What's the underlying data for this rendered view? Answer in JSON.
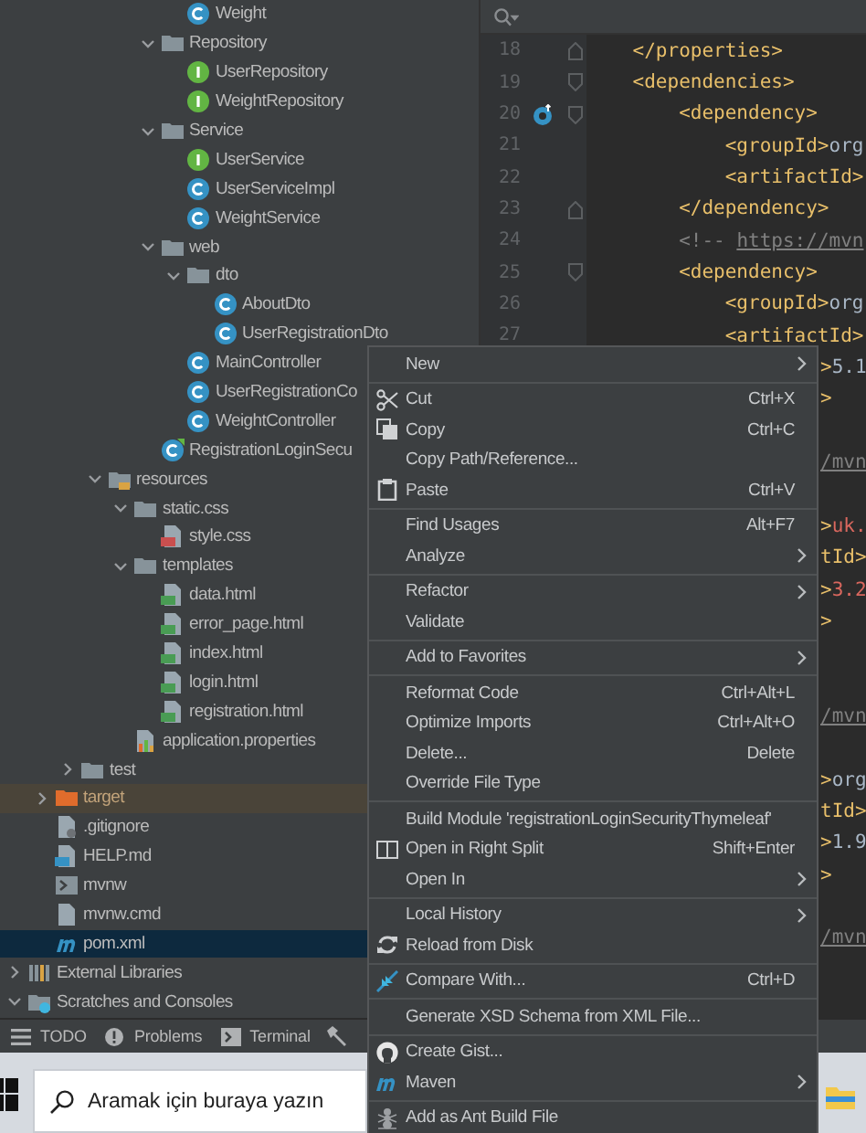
{
  "tree": [
    {
      "children": [
        {
          "children": [
            {
              "children": [
                {
                  "children": [
                    {
                      "children": [
                        {
                          "children": [
                            {
                              "label": "Weight",
                              "kind": "class",
                              "selected": false
                            }
                          ]
                        },
                        {
                          "label": "Repository",
                          "kind": "folder",
                          "expanded": true,
                          "selected": false,
                          "children": [
                            {
                              "label": "UserRepository",
                              "kind": "interface",
                              "selected": false
                            },
                            {
                              "label": "WeightRepository",
                              "kind": "interface",
                              "selected": false
                            }
                          ]
                        },
                        {
                          "label": "Service",
                          "kind": "folder",
                          "expanded": true,
                          "selected": false,
                          "children": [
                            {
                              "label": "UserService",
                              "kind": "interface",
                              "selected": false
                            },
                            {
                              "label": "UserServiceImpl",
                              "kind": "class",
                              "selected": false
                            },
                            {
                              "label": "WeightService",
                              "kind": "class",
                              "selected": false
                            }
                          ]
                        },
                        {
                          "label": "web",
                          "kind": "folder",
                          "expanded": true,
                          "selected": false,
                          "children": [
                            {
                              "label": "dto",
                              "kind": "folder",
                              "expanded": true,
                              "selected": false,
                              "children": [
                                {
                                  "label": "AboutDto",
                                  "kind": "class",
                                  "selected": false
                                },
                                {
                                  "label": "UserRegistrationDto",
                                  "kind": "class",
                                  "selected": false
                                }
                              ]
                            },
                            {
                              "label": "MainController",
                              "kind": "class",
                              "selected": false
                            },
                            {
                              "label": "UserRegistrationCo",
                              "kind": "class",
                              "selected": false
                            },
                            {
                              "label": "WeightController",
                              "kind": "class",
                              "selected": false
                            }
                          ]
                        },
                        {
                          "label": "RegistrationLoginSecu",
                          "kind": "app",
                          "selected": false
                        }
                      ]
                    }
                  ]
                },
                {
                  "label": "resources",
                  "kind": "resources",
                  "expanded": true,
                  "selected": false,
                  "children": [
                    {
                      "label": "static.css",
                      "kind": "folder",
                      "expanded": true,
                      "selected": false,
                      "children": [
                        {
                          "label": "style.css",
                          "kind": "css",
                          "selected": false
                        }
                      ]
                    },
                    {
                      "label": "templates",
                      "kind": "folder",
                      "expanded": true,
                      "selected": false,
                      "children": [
                        {
                          "label": "data.html",
                          "kind": "html",
                          "selected": false
                        },
                        {
                          "label": "error_page.html",
                          "kind": "html",
                          "selected": false
                        },
                        {
                          "label": "index.html",
                          "kind": "html",
                          "selected": false
                        },
                        {
                          "label": "login.html",
                          "kind": "html",
                          "selected": false
                        },
                        {
                          "label": "registration.html",
                          "kind": "html",
                          "selected": false
                        }
                      ]
                    },
                    {
                      "label": "application.properties",
                      "kind": "properties",
                      "selected": false
                    }
                  ]
                }
              ]
            },
            {
              "label": "test",
              "kind": "folder",
              "expanded": false,
              "selected": false
            }
          ]
        },
        {
          "label": "target",
          "kind": "excluded",
          "expanded": false,
          "selected": false
        },
        {
          "label": ".gitignore",
          "kind": "git",
          "selected": false
        },
        {
          "label": "HELP.md",
          "kind": "md",
          "selected": false
        },
        {
          "label": "mvnw",
          "kind": "terminal",
          "selected": false
        },
        {
          "label": "mvnw.cmd",
          "kind": "file",
          "selected": false
        },
        {
          "label": "pom.xml",
          "kind": "maven",
          "selected": true
        }
      ]
    },
    {
      "label": "External Libraries",
      "kind": "libraries",
      "expanded": false,
      "selected": false
    },
    {
      "label": "Scratches and Consoles",
      "kind": "scratches",
      "expanded": true,
      "selected": false
    }
  ],
  "editor": {
    "lines": [
      {
        "number": "18",
        "kind": "fold-close",
        "parts": [
          {
            "text": "    </properties>",
            "kind": "tag"
          }
        ]
      },
      {
        "number": "19",
        "kind": "fold-open",
        "parts": [
          {
            "text": "    <dependencies>",
            "kind": "tag"
          }
        ]
      },
      {
        "number": "20",
        "kind": "fold-open",
        "marker": true,
        "parts": [
          {
            "text": "        <dependency>",
            "kind": "tag"
          }
        ]
      },
      {
        "number": "21",
        "kind": "plain",
        "parts": [
          {
            "text": "            <groupId>",
            "kind": "tag"
          },
          {
            "text": "org",
            "kind": "text"
          }
        ]
      },
      {
        "number": "22",
        "kind": "plain",
        "parts": [
          {
            "text": "            <artifactId>",
            "kind": "tag"
          }
        ]
      },
      {
        "number": "23",
        "kind": "fold-close",
        "parts": [
          {
            "text": "        </dependency>",
            "kind": "tag"
          }
        ]
      },
      {
        "number": "24",
        "kind": "plain",
        "parts": [
          {
            "text": "        <!-- ",
            "kind": "comment"
          },
          {
            "text": "https://mvn",
            "kind": "link"
          }
        ]
      },
      {
        "number": "25",
        "kind": "fold-open",
        "parts": [
          {
            "text": "        <dependency>",
            "kind": "tag"
          }
        ]
      },
      {
        "number": "26",
        "kind": "plain",
        "parts": [
          {
            "text": "            <groupId>",
            "kind": "tag"
          },
          {
            "text": "org",
            "kind": "text"
          }
        ]
      },
      {
        "number": "27",
        "kind": "plain",
        "parts": [
          {
            "text": "            <artifactId>",
            "kind": "tag"
          }
        ]
      },
      {
        "kind": "tail",
        "parts": [
          {
            "text": ">",
            "kind": "tag"
          },
          {
            "text": "5.1",
            "kind": "text"
          }
        ]
      },
      {
        "kind": "tail",
        "parts": [
          {
            "text": ">",
            "kind": "tag"
          }
        ]
      },
      {
        "kind": "blank"
      },
      {
        "kind": "tail",
        "parts": [
          {
            "text": "/mvn",
            "kind": "link"
          }
        ]
      },
      {
        "kind": "blank"
      },
      {
        "kind": "tail",
        "parts": [
          {
            "text": ">",
            "kind": "tag"
          },
          {
            "text": "uk.",
            "kind": "red"
          }
        ]
      },
      {
        "kind": "tail",
        "parts": [
          {
            "text": "tId>",
            "kind": "tag"
          }
        ]
      },
      {
        "kind": "tail",
        "parts": [
          {
            "text": ">",
            "kind": "tag"
          },
          {
            "text": "3.2",
            "kind": "red"
          }
        ]
      },
      {
        "kind": "tail",
        "parts": [
          {
            "text": ">",
            "kind": "tag"
          }
        ]
      },
      {
        "kind": "blank"
      },
      {
        "kind": "blank"
      },
      {
        "kind": "tail",
        "parts": [
          {
            "text": "/mvn",
            "kind": "link"
          }
        ]
      },
      {
        "kind": "blank"
      },
      {
        "kind": "tail",
        "parts": [
          {
            "text": ">",
            "kind": "tag"
          },
          {
            "text": "org",
            "kind": "text"
          }
        ]
      },
      {
        "kind": "tail",
        "parts": [
          {
            "text": "tId>",
            "kind": "tag"
          }
        ]
      },
      {
        "kind": "tail",
        "parts": [
          {
            "text": ">",
            "kind": "tag"
          },
          {
            "text": "1.9",
            "kind": "text"
          }
        ]
      },
      {
        "kind": "tail",
        "parts": [
          {
            "text": ">",
            "kind": "tag"
          }
        ]
      },
      {
        "kind": "blank"
      },
      {
        "kind": "tail",
        "parts": [
          {
            "text": "/mvn",
            "kind": "link"
          }
        ]
      }
    ]
  },
  "context_menu": {
    "groups": [
      [
        {
          "label": "New",
          "submenu": true
        }
      ],
      [
        {
          "label": "Cut",
          "kind": "scissors",
          "shortcut": "Ctrl+X"
        },
        {
          "label": "Copy",
          "kind": "copy",
          "shortcut": "Ctrl+C"
        },
        {
          "label": "Copy Path/Reference..."
        },
        {
          "label": "Paste",
          "kind": "paste",
          "shortcut": "Ctrl+V"
        }
      ],
      [
        {
          "label": "Find Usages",
          "shortcut": "Alt+F7"
        },
        {
          "label": "Analyze",
          "submenu": true
        }
      ],
      [
        {
          "label": "Refactor",
          "submenu": true
        },
        {
          "label": "Validate"
        }
      ],
      [
        {
          "label": "Add to Favorites",
          "submenu": true
        }
      ],
      [
        {
          "label": "Reformat Code",
          "shortcut": "Ctrl+Alt+L"
        },
        {
          "label": "Optimize Imports",
          "shortcut": "Ctrl+Alt+O"
        },
        {
          "label": "Delete...",
          "shortcut": "Delete"
        },
        {
          "label": "Override File Type"
        }
      ],
      [
        {
          "label": "Build Module 'registrationLoginSecurityThymeleaf'"
        },
        {
          "label": "Open in Right Split",
          "kind": "split",
          "shortcut": "Shift+Enter"
        },
        {
          "label": "Open In",
          "submenu": true
        }
      ],
      [
        {
          "label": "Local History",
          "submenu": true
        },
        {
          "label": "Reload from Disk",
          "kind": "reload"
        }
      ],
      [
        {
          "label": "Compare With...",
          "kind": "compare",
          "shortcut": "Ctrl+D"
        }
      ],
      [
        {
          "label": "Generate XSD Schema from XML File..."
        }
      ],
      [
        {
          "label": "Create Gist...",
          "kind": "github"
        },
        {
          "label": "Maven",
          "kind": "maven",
          "submenu": true
        }
      ],
      [
        {
          "label": "Add as Ant Build File",
          "kind": "ant"
        }
      ]
    ]
  },
  "tool_windows": [
    {
      "label": "TODO",
      "kind": "list"
    },
    {
      "label": "Problems",
      "kind": "problems"
    },
    {
      "label": "Terminal",
      "kind": "terminal"
    }
  ],
  "taskbar": {
    "search": {
      "placeholder": "Aramak için buraya yazın"
    }
  }
}
